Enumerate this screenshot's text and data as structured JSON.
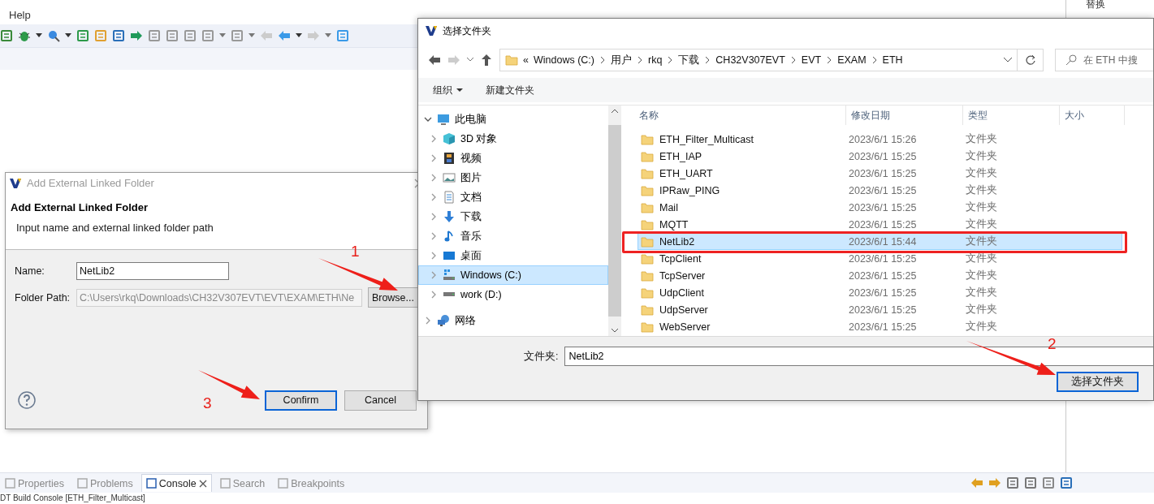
{
  "ide": {
    "menu": [
      {
        "label": "Help"
      }
    ],
    "side_panel": {
      "label": "替换"
    },
    "view_tabs": [
      {
        "label": "Properties",
        "selected": false
      },
      {
        "label": "Problems",
        "selected": false
      },
      {
        "label": "Console",
        "selected": true
      },
      {
        "label": "Search",
        "selected": false
      },
      {
        "label": "Breakpoints",
        "selected": false
      }
    ],
    "console_title": "DT Build Console [ETH_Filter_Multicast]"
  },
  "link_dialog": {
    "title": "Add External Linked Folder",
    "heading": "Add External Linked Folder",
    "description": "Input name and external linked folder path",
    "name_label": "Name:",
    "name_value": "NetLib2",
    "path_label": "Folder Path:",
    "path_value": "C:\\Users\\rkq\\Downloads\\CH32V307EVT\\EVT\\EXAM\\ETH\\Ne",
    "path_disabled": true,
    "browse": "Browse...",
    "buttons": [
      {
        "label": "Confirm",
        "focused": true
      },
      {
        "label": "Cancel",
        "focused": false
      }
    ]
  },
  "folder_dialog": {
    "title": "选择文件夹",
    "breadcrumb_prefix": "«",
    "breadcrumb": [
      "Windows (C:)",
      "用户",
      "rkq",
      "下载",
      "CH32V307EVT",
      "EVT",
      "EXAM",
      "ETH"
    ],
    "search_placeholder": "在 ETH 中搜",
    "toolbar": [
      {
        "label": "组织",
        "has_menu": true
      },
      {
        "label": "新建文件夹",
        "has_menu": false
      }
    ],
    "tree": [
      {
        "label": "此电脑",
        "kind": "pc",
        "expanded": true,
        "selected": false,
        "children": [
          {
            "label": "3D 对象",
            "kind": "cube",
            "expanded": false,
            "selected": false
          },
          {
            "label": "视频",
            "kind": "film",
            "expanded": false,
            "selected": false
          },
          {
            "label": "图片",
            "kind": "image",
            "expanded": false,
            "selected": false
          },
          {
            "label": "文档",
            "kind": "doc",
            "expanded": false,
            "selected": false
          },
          {
            "label": "下载",
            "kind": "download",
            "expanded": false,
            "selected": false
          },
          {
            "label": "音乐",
            "kind": "music",
            "expanded": false,
            "selected": false
          },
          {
            "label": "桌面",
            "kind": "desktop",
            "expanded": false,
            "selected": false
          },
          {
            "label": "Windows (C:)",
            "kind": "windrive",
            "expanded": false,
            "selected": true
          },
          {
            "label": "work (D:)",
            "kind": "drive",
            "expanded": false,
            "selected": false
          }
        ]
      },
      {
        "label": "网络",
        "kind": "network",
        "expanded": false,
        "selected": false
      }
    ],
    "columns": [
      "名称",
      "修改日期",
      "类型",
      "大小"
    ],
    "rows": [
      {
        "name": "ETH_Filter_Multicast",
        "modified": "2023/6/1 15:26",
        "type": "文件夹",
        "selected": false
      },
      {
        "name": "ETH_IAP",
        "modified": "2023/6/1 15:25",
        "type": "文件夹",
        "selected": false
      },
      {
        "name": "ETH_UART",
        "modified": "2023/6/1 15:25",
        "type": "文件夹",
        "selected": false
      },
      {
        "name": "IPRaw_PING",
        "modified": "2023/6/1 15:25",
        "type": "文件夹",
        "selected": false
      },
      {
        "name": "Mail",
        "modified": "2023/6/1 15:25",
        "type": "文件夹",
        "selected": false
      },
      {
        "name": "MQTT",
        "modified": "2023/6/1 15:25",
        "type": "文件夹",
        "selected": false
      },
      {
        "name": "NetLib2",
        "modified": "2023/6/1 15:44",
        "type": "文件夹",
        "selected": true
      },
      {
        "name": "TcpClient",
        "modified": "2023/6/1 15:25",
        "type": "文件夹",
        "selected": false
      },
      {
        "name": "TcpServer",
        "modified": "2023/6/1 15:25",
        "type": "文件夹",
        "selected": false
      },
      {
        "name": "UdpClient",
        "modified": "2023/6/1 15:25",
        "type": "文件夹",
        "selected": false
      },
      {
        "name": "UdpServer",
        "modified": "2023/6/1 15:25",
        "type": "文件夹",
        "selected": false
      },
      {
        "name": "WebServer",
        "modified": "2023/6/1 15:25",
        "type": "文件夹",
        "selected": false
      }
    ],
    "folder_label": "文件夹:",
    "folder_value": "NetLib2",
    "buttons": [
      {
        "label": "选择文件夹",
        "focused": true
      }
    ]
  },
  "annotations": [
    {
      "label": "1"
    },
    {
      "label": "2"
    },
    {
      "label": "3"
    }
  ]
}
